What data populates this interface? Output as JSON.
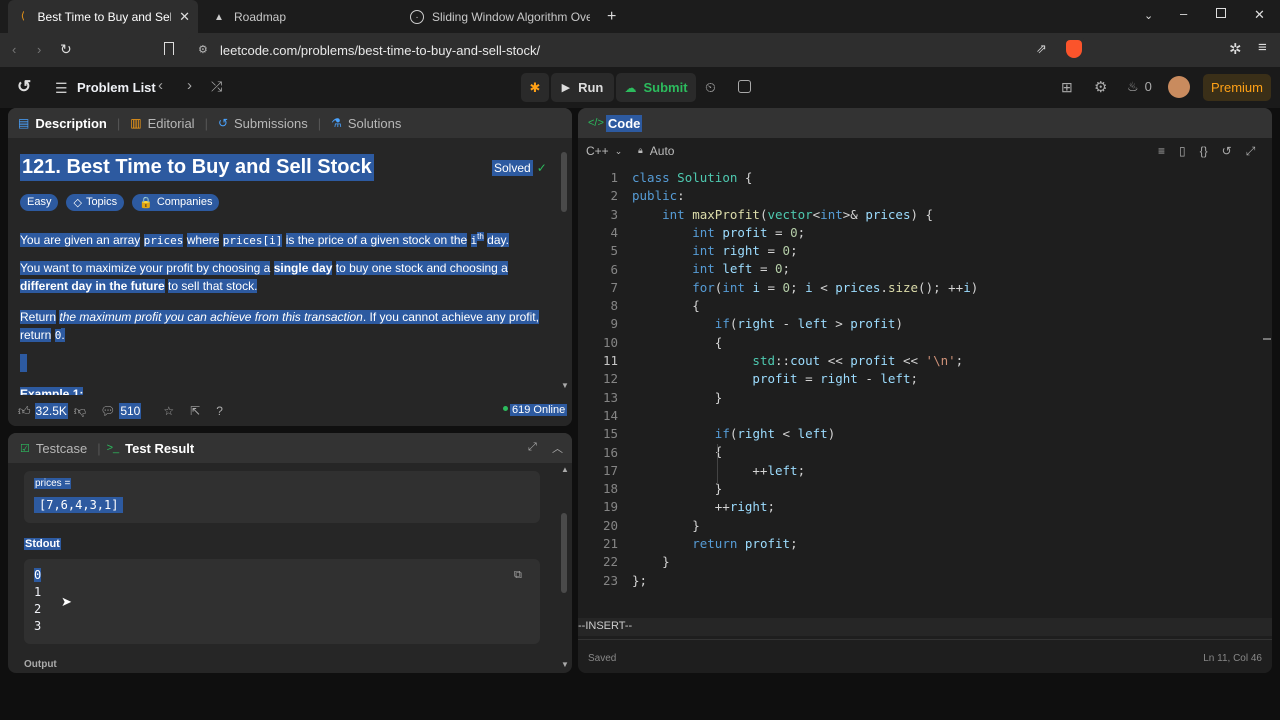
{
  "browser": {
    "tabs": [
      {
        "title": "Best Time to Buy and Sell Stock",
        "active": true
      },
      {
        "title": "Roadmap",
        "active": false
      },
      {
        "title": "Sliding Window Algorithm Overvie",
        "active": false
      }
    ],
    "url": "leetcode.com/problems/best-time-to-buy-and-sell-stock/"
  },
  "nav": {
    "problem_list": "Problem List",
    "run": "Run",
    "submit": "Submit",
    "streak": "0",
    "premium": "Premium"
  },
  "left_tabs": [
    "Description",
    "Editorial",
    "Submissions",
    "Solutions"
  ],
  "problem": {
    "title": "121. Best Time to Buy and Sell Stock",
    "solved": "Solved",
    "difficulty": "Easy",
    "topics": "Topics",
    "companies": "Companies",
    "p1_a": "You are given an array",
    "p1_code1": "prices",
    "p1_b": "where",
    "p1_code2": "prices[i]",
    "p1_c": "is the price of a given stock on the",
    "p1_code3": "i",
    "p1_sup": "th",
    "p1_d": "day.",
    "p2_a": "You want to maximize your profit by choosing a",
    "p2_b": "single day",
    "p2_c": "to buy one stock and choosing a",
    "p2_d": "different day in the future",
    "p2_e": "to sell that stock.",
    "p3_a": "Return",
    "p3_b": "the maximum profit you can achieve from this transaction",
    "p3_c": ". If you cannot achieve any profit, return",
    "p3_code": "0",
    "p3_d": ".",
    "example": "Example 1:",
    "likes": "32.5K",
    "comments": "510",
    "online": "619 Online"
  },
  "bottom": {
    "tabs": [
      "Testcase",
      "Test Result"
    ],
    "input_label": "prices =",
    "input_value": "[7,6,4,3,1]",
    "stdout_label": "Stdout",
    "stdout_lines": [
      "0",
      "1",
      "2",
      "3"
    ],
    "output_label": "Output"
  },
  "editor": {
    "tab": "Code",
    "language": "C++",
    "mode": "Auto",
    "status": "--INSERT--",
    "saved": "Saved",
    "cursor": "Ln 11, Col 46",
    "line_numbers": [
      "1",
      "2",
      "3",
      "4",
      "5",
      "6",
      "7",
      "8",
      "9",
      "10",
      "11",
      "12",
      "13",
      "14",
      "15",
      "16",
      "17",
      "18",
      "19",
      "20",
      "21",
      "22",
      "23"
    ]
  }
}
